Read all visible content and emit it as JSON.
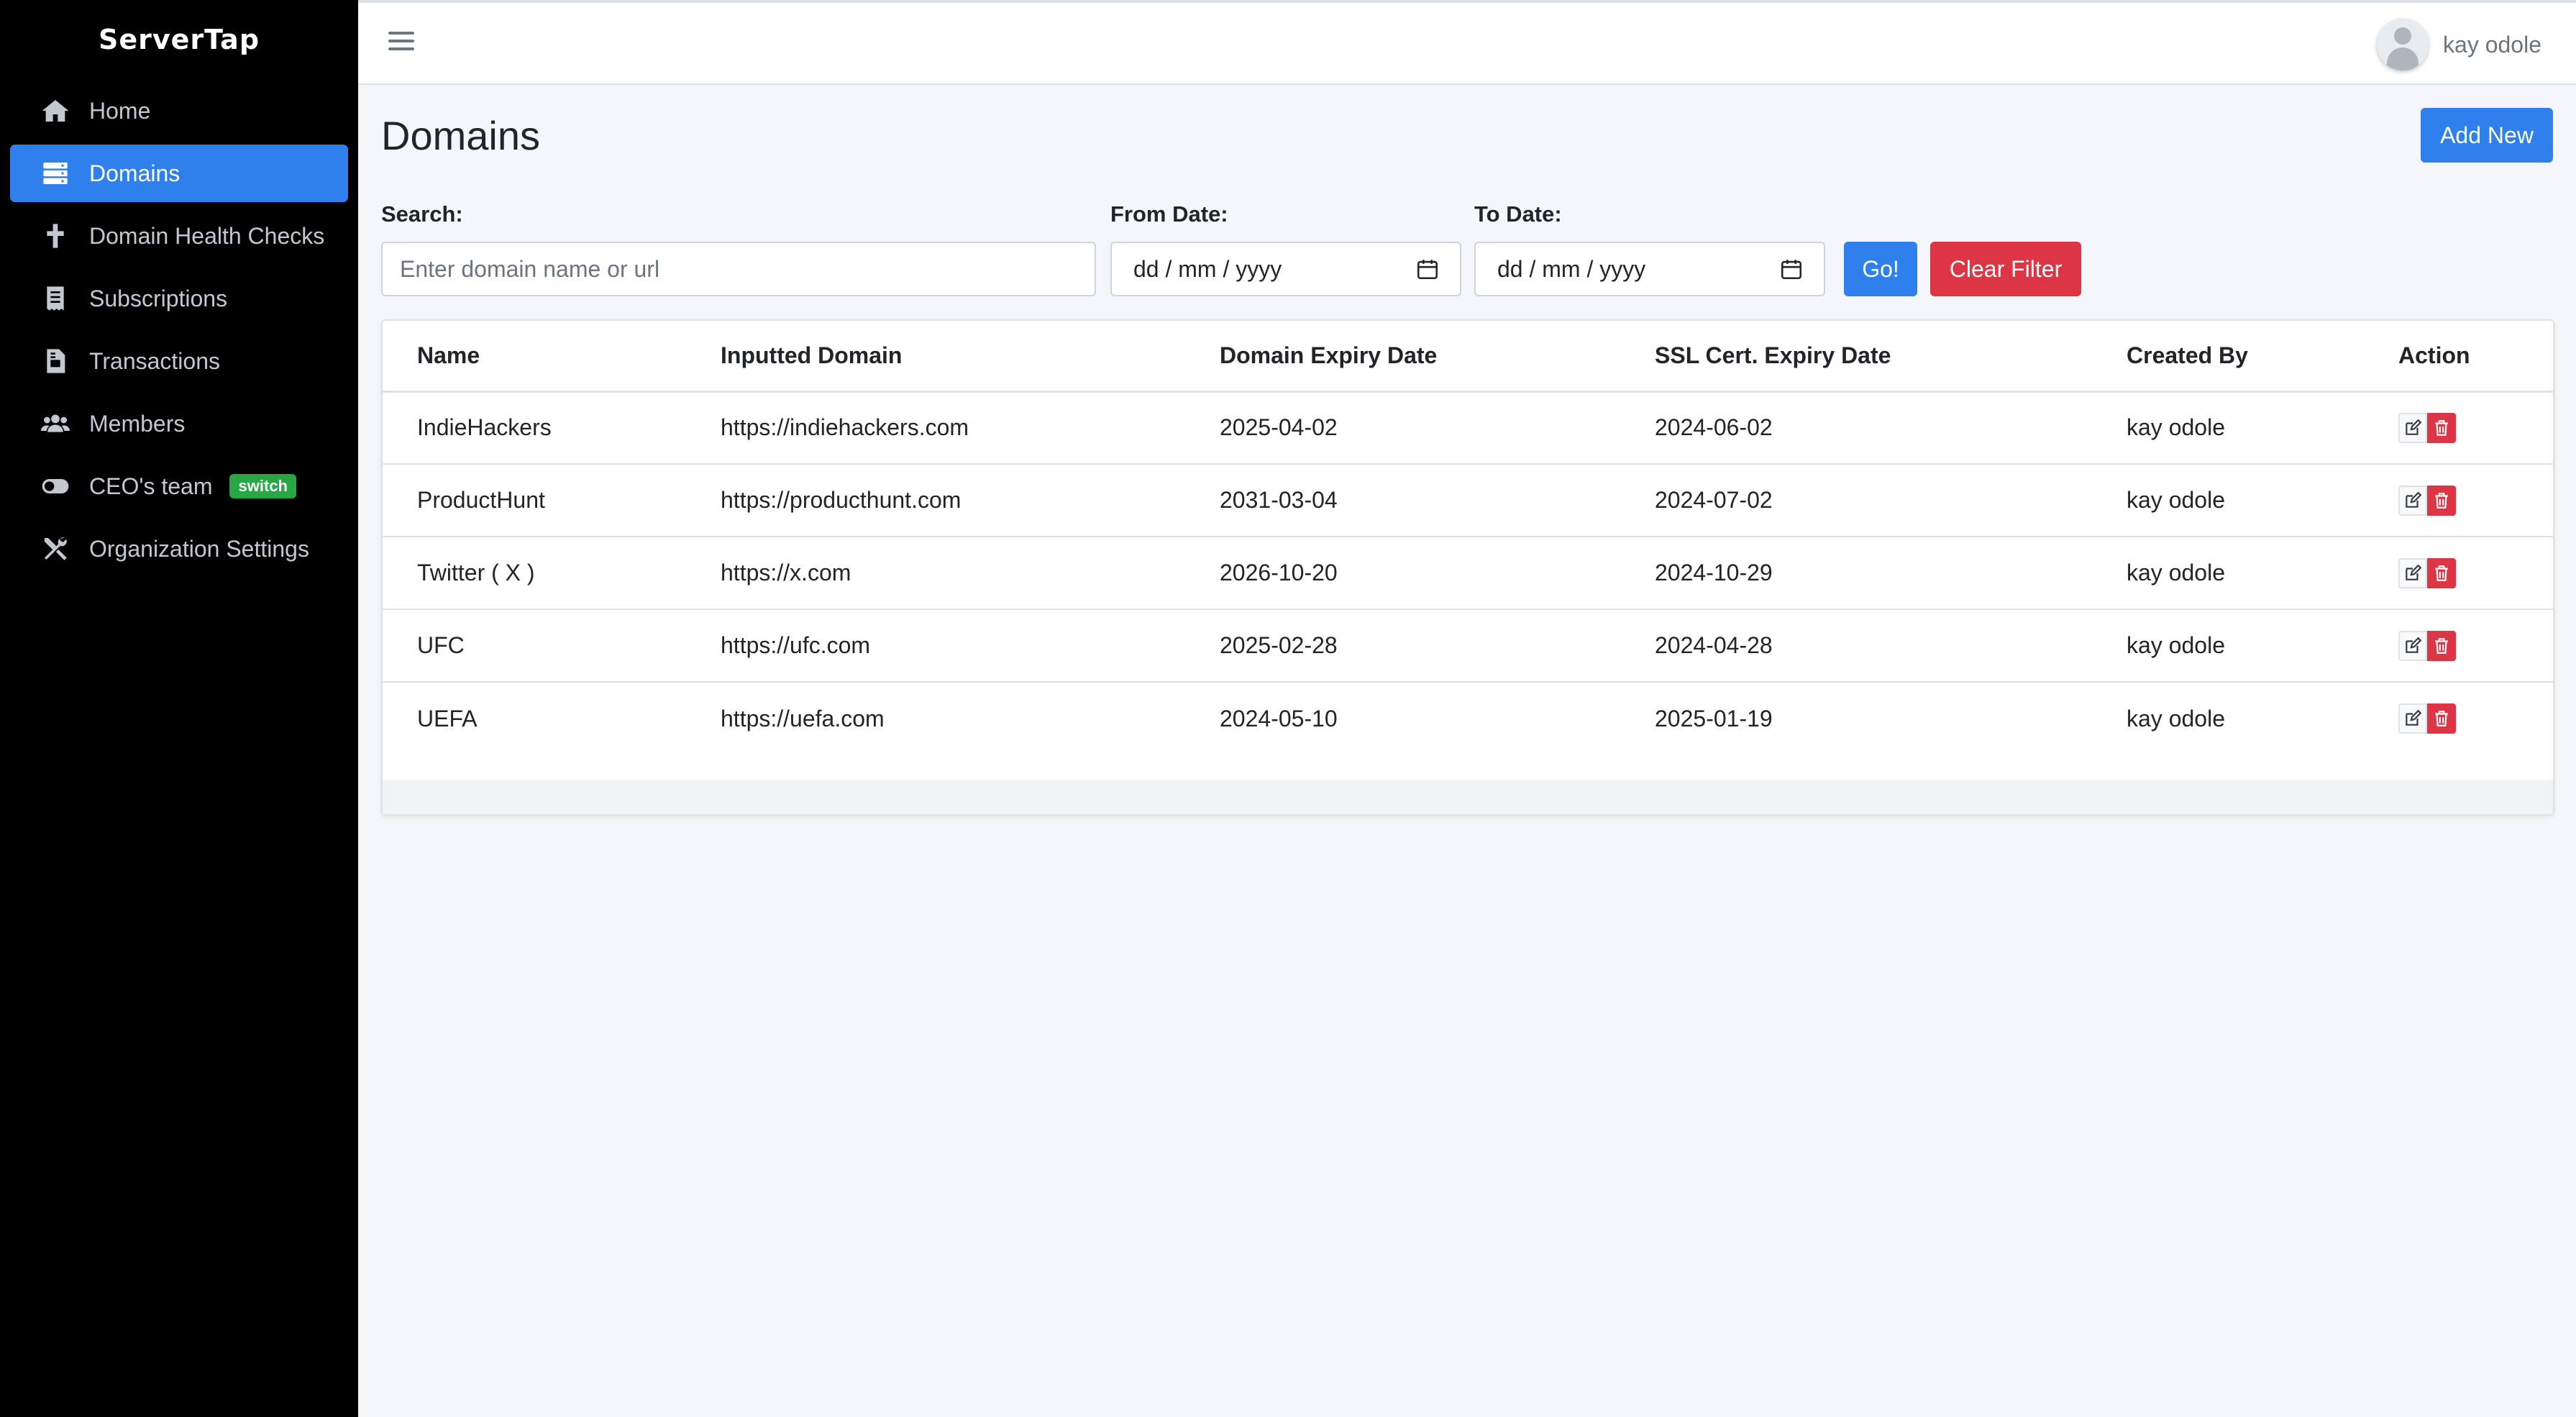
{
  "app": {
    "brand": "ServerTap",
    "accent": "#2f80ed",
    "danger": "#dc3545",
    "success": "#28a745"
  },
  "sidebar": {
    "items": [
      {
        "label": "Home",
        "icon": "home-icon",
        "active": false
      },
      {
        "label": "Domains",
        "icon": "server-icon",
        "active": true
      },
      {
        "label": "Domain Health Checks",
        "icon": "cross-icon",
        "active": false
      },
      {
        "label": "Subscriptions",
        "icon": "receipt-icon",
        "active": false
      },
      {
        "label": "Transactions",
        "icon": "invoice-icon",
        "active": false
      },
      {
        "label": "Members",
        "icon": "users-icon",
        "active": false
      },
      {
        "label": "CEO's team",
        "icon": "toggle-icon",
        "active": false,
        "badge": "switch"
      },
      {
        "label": "Organization Settings",
        "icon": "tools-icon",
        "active": false
      }
    ]
  },
  "topbar": {
    "user_name": "kay odole"
  },
  "page": {
    "title": "Domains",
    "add_new": "Add New"
  },
  "filters": {
    "search_label": "Search:",
    "search_placeholder": "Enter domain name or url",
    "from_label": "From Date:",
    "from_value": "dd / mm / yyyy",
    "to_label": "To Date:",
    "to_value": "dd / mm / yyyy",
    "go": "Go!",
    "clear": "Clear Filter"
  },
  "table": {
    "headers": [
      "Name",
      "Inputted Domain",
      "Domain Expiry Date",
      "SSL Cert. Expiry Date",
      "Created By",
      "Action"
    ],
    "rows": [
      [
        "IndieHackers",
        "https://indiehackers.com",
        "2025-04-02",
        "2024-06-02",
        "kay odole"
      ],
      [
        "ProductHunt",
        "https://producthunt.com",
        "2031-03-04",
        "2024-07-02",
        "kay odole"
      ],
      [
        "Twitter ( X )",
        "https://x.com",
        "2026-10-20",
        "2024-10-29",
        "kay odole"
      ],
      [
        "UFC",
        "https://ufc.com",
        "2025-02-28",
        "2024-04-28",
        "kay odole"
      ],
      [
        "UEFA",
        "https://uefa.com",
        "2024-05-10",
        "2025-01-19",
        "kay odole"
      ]
    ]
  }
}
